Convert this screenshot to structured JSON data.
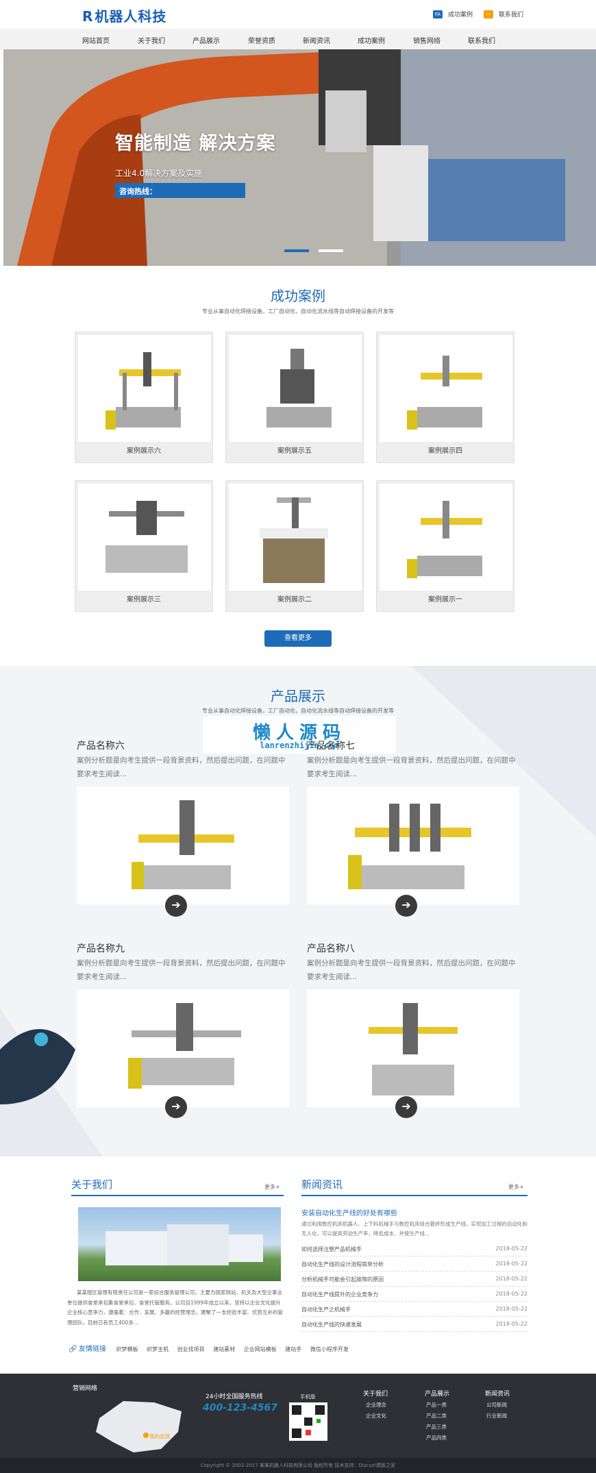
{
  "header": {
    "logo_mark": "R",
    "logo_text": "机器人科技",
    "top_links": [
      "成功案例",
      "联系我们"
    ],
    "top_icons": [
      "FA",
      "wave-icon"
    ]
  },
  "nav": [
    "网站首页",
    "关于我们",
    "产品展示",
    "荣誉资质",
    "新闻资讯",
    "成功案例",
    "销售网络",
    "联系我们"
  ],
  "hero": {
    "title": "智能制造 解决方案",
    "subtitle": "工业4.0解决方案及实施",
    "hotline_label": "咨询热线："
  },
  "cases": {
    "title": "成功案例",
    "subtitle": "专业从事自动化焊接设备，工厂自动化，自动化流水线等自动焊接设备的开发等",
    "items": [
      "案例展示六",
      "案例展示五",
      "案例展示四",
      "案例展示三",
      "案例展示二",
      "案例展示一"
    ],
    "more": "查看更多"
  },
  "products": {
    "title": "产品展示",
    "subtitle": "专业从事自动化焊接设备，工厂自动化，自动化流水线等自动焊接设备的开发等",
    "items": [
      {
        "name": "产品名称六",
        "desc": "案例分析题是向考生提供一段背景资料，然后提出问题，在问题中要求考生阅读..."
      },
      {
        "name": "产品名称七",
        "desc": "案例分析题是向考生提供一段背景资料，然后提出问题，在问题中要求考生阅读..."
      },
      {
        "name": "产品名称九",
        "desc": "案例分析题是向考生提供一段背景资料，然后提出问题，在问题中要求考生阅读..."
      },
      {
        "name": "产品名称八",
        "desc": "案例分析题是向考生提供一段背景资料，然后提出问题，在问题中要求考生阅读..."
      }
    ]
  },
  "watermark": {
    "cn": "懒人源码",
    "url": "lanrenzhijia.com"
  },
  "about": {
    "title": "关于我们",
    "more": "更多+",
    "text": "某某暗区管理有限责任公司是一家综合服务管理公司，主要为国家网站、机关及大型企事业单位提供食堂承包集食堂承包、食堂托管服务。公司自1999年成立以来，坚持以企业文化提升企业核心竞争力，遵循着：合作、发展、多赢的经营理念，建聚了一支经验丰富、优势互补的管理团队，目前已有员工400多..."
  },
  "news": {
    "title": "新闻资讯",
    "more": "更多+",
    "headline": "安装自动化生产线的好处有哪些",
    "summary": "通过利用数控机床机器人、上下料机械手与数控机床组合最终形成生产线，实现加工过程的自动化和无人化，可以提高劳动生产率，降低成本，并使生产线...",
    "rows": [
      {
        "t": "如何选择注塑产品机械手",
        "d": "2018-05-22"
      },
      {
        "t": "自动化生产线的设计流程简单分析",
        "d": "2018-05-22"
      },
      {
        "t": "分析机械手可能会引起故障的原因",
        "d": "2018-05-22"
      },
      {
        "t": "自动化生产线提升的企业竞争力",
        "d": "2018-05-22"
      },
      {
        "t": "自动化生产之机械手",
        "d": "2018-05-22"
      },
      {
        "t": "自动化生产线的快速发展",
        "d": "2018-05-22"
      }
    ]
  },
  "links": {
    "title": "友情链接",
    "items": [
      "织梦模板",
      "织梦主机",
      "创业找项目",
      "建站素材",
      "企业网站模板",
      "建站手",
      "微信小程序开发"
    ]
  },
  "footer": {
    "network": "营销网络",
    "hq": " 我的总部",
    "hotline_label": "24小时全国服务热线",
    "phone": "400-123-4567",
    "mobile": "手机版",
    "cols": [
      {
        "t": "关于我们",
        "i": [
          "企业理念",
          "企业文化"
        ]
      },
      {
        "t": "产品展示",
        "i": [
          "产品一类",
          "产品二类",
          "产品三类",
          "产品四类"
        ]
      },
      {
        "t": "新闻资讯",
        "i": [
          "公司新闻",
          "行业新闻"
        ]
      }
    ],
    "copyright": "Copyright © 2002-2017 某某机器人科技有限公司 版权所有 技术支持：Discuz!模板之家"
  },
  "colors": {
    "accent": "#1e6bb8",
    "footer": "#2d3035"
  }
}
